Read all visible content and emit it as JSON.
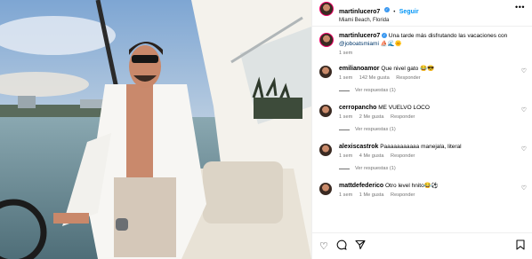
{
  "post": {
    "username": "martinlucero7",
    "verified_mark": "✓",
    "separator": "•",
    "follow_label": "Seguir",
    "location": "Miami Beach, Florida",
    "more_icon": "more-icon"
  },
  "caption": {
    "username": "martinlucero7",
    "text": "Una tarde más disfrutando las vacaciones con",
    "mention": "@joboatsmiami",
    "emojis": "⛵🌊🌞",
    "time": "1 sem"
  },
  "comments": [
    {
      "username": "emilianoamor",
      "text": "Que nivel gato 😂😎",
      "time": "1 sem",
      "likes": "142 Me gusta",
      "reply_label": "Responder",
      "replies": "Ver respuestas (1)"
    },
    {
      "username": "cerropancho",
      "text": "ME VUELVO LOCO",
      "time": "1 sem",
      "likes": "2 Me gusta",
      "reply_label": "Responder",
      "replies": "Ver respuestas (1)"
    },
    {
      "username": "alexiscastrok",
      "text": "Paaaaaaaaaaa manejala, literal",
      "time": "1 sem",
      "likes": "4 Me gusta",
      "reply_label": "Responder",
      "replies": "Ver respuestas (1)"
    },
    {
      "username": "mattdefederico",
      "text": "Otro level hnito😂⚽",
      "time": "1 sem",
      "likes": "1 Me gusta",
      "reply_label": "Responder"
    }
  ],
  "actions": {
    "like_icon": "heart-icon",
    "comment_icon": "comment-icon",
    "share_icon": "share-icon",
    "save_icon": "bookmark-icon"
  },
  "colors": {
    "accent": "#0095f6",
    "verified": "#3897f0",
    "link": "#00376b"
  }
}
